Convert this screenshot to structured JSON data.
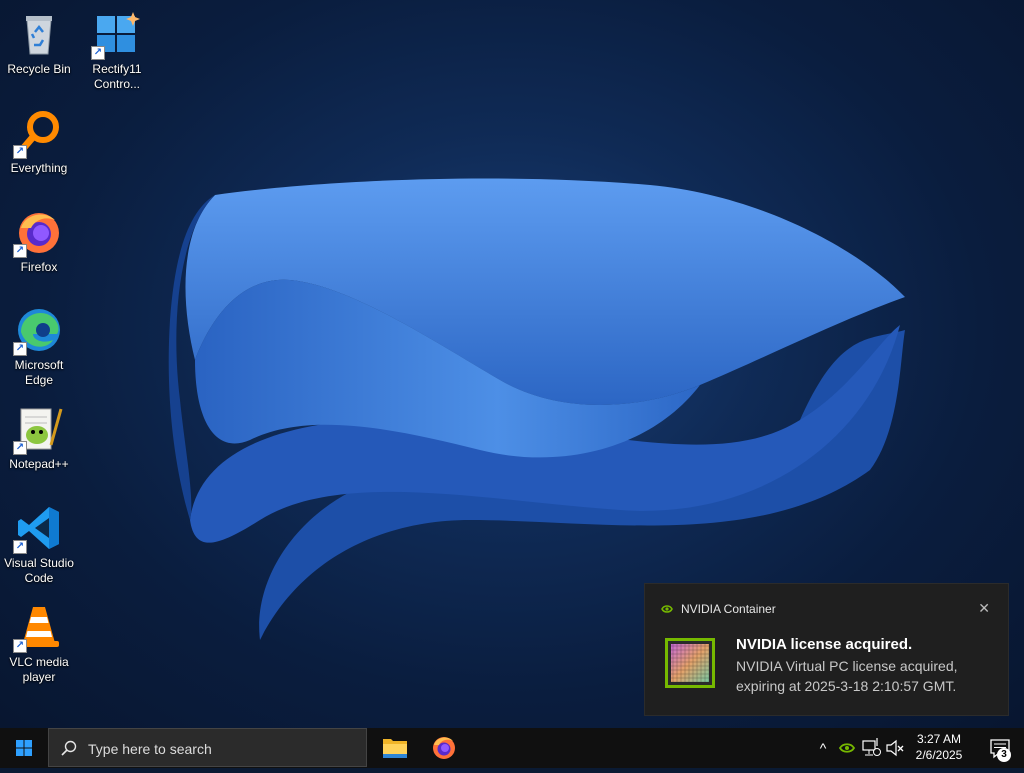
{
  "desktop": {
    "icons": [
      {
        "label": "Recycle Bin",
        "icon": "recycle-bin-icon"
      },
      {
        "label": "Rectify11 Contro...",
        "icon": "rectify11-icon"
      },
      {
        "label": "Everything",
        "icon": "everything-search-icon"
      },
      {
        "label": "Firefox",
        "icon": "firefox-icon"
      },
      {
        "label": "Microsoft Edge",
        "icon": "edge-icon"
      },
      {
        "label": "Notepad++",
        "icon": "notepad-plus-plus-icon"
      },
      {
        "label": "Visual Studio Code",
        "icon": "vscode-icon"
      },
      {
        "label": "VLC media player",
        "icon": "vlc-icon"
      }
    ]
  },
  "notification": {
    "app": "NVIDIA Container",
    "title": "NVIDIA license acquired.",
    "body": "NVIDIA Virtual PC license acquired, expiring at 2025-3-18 2:10:57 GMT.",
    "close_symbol": "✕"
  },
  "taskbar": {
    "search_placeholder": "Type here to search",
    "pinned": [
      {
        "name": "File Explorer",
        "icon": "file-explorer-icon"
      },
      {
        "name": "Firefox",
        "icon": "firefox-icon"
      }
    ],
    "tray": {
      "chevron": "^",
      "time": "3:27 AM",
      "date": "2/6/2025",
      "notification_count": "3"
    }
  },
  "colors": {
    "accent": "#0078d4",
    "nvidia_green": "#76b900",
    "wallpaper_blue": "#2f6fd0"
  }
}
